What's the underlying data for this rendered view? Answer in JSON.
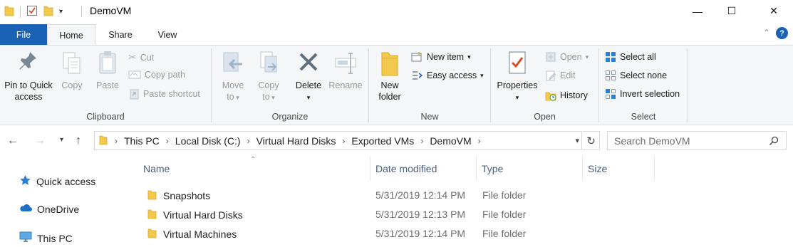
{
  "window": {
    "title": "DemoVM",
    "minimize_glyph": "—",
    "maximize_glyph": "☐",
    "close_glyph": "✕"
  },
  "tabs": [
    {
      "label": "File"
    },
    {
      "label": "Home"
    },
    {
      "label": "Share"
    },
    {
      "label": "View"
    }
  ],
  "ribbon": {
    "collapse_glyph": "⌃",
    "help_glyph": "?",
    "clipboard": {
      "label": "Clipboard",
      "pin": "Pin to Quick access",
      "pin_line1": "Pin to Quick",
      "pin_line2": "access",
      "copy": "Copy",
      "paste": "Paste",
      "cut": "Cut",
      "copy_path": "Copy path",
      "paste_shortcut": "Paste shortcut"
    },
    "organize": {
      "label": "Organize",
      "move_to_line1": "Move",
      "move_to_line2": "to",
      "copy_to_line1": "Copy",
      "copy_to_line2": "to",
      "delete": "Delete",
      "rename": "Rename"
    },
    "new": {
      "label": "New",
      "new_folder_line1": "New",
      "new_folder_line2": "folder",
      "new_item": "New item",
      "easy_access": "Easy access"
    },
    "open": {
      "label": "Open",
      "properties": "Properties",
      "open": "Open",
      "edit": "Edit",
      "history": "History"
    },
    "select": {
      "label": "Select",
      "select_all": "Select all",
      "select_none": "Select none",
      "invert_selection": "Invert selection"
    }
  },
  "address": {
    "crumbs": [
      "This PC",
      "Local Disk (C:)",
      "Virtual Hard Disks",
      "Exported VMs",
      "DemoVM"
    ]
  },
  "search": {
    "placeholder": "Search DemoVM"
  },
  "navpane": {
    "items": [
      {
        "label": "Quick access",
        "icon": "star-icon"
      },
      {
        "label": "OneDrive",
        "icon": "cloud-icon"
      },
      {
        "label": "This PC",
        "icon": "computer-icon"
      }
    ]
  },
  "columns": {
    "name": "Name",
    "date": "Date modified",
    "type": "Type",
    "size": "Size"
  },
  "files": [
    {
      "name": "Snapshots",
      "date": "5/31/2019 12:14 PM",
      "type": "File folder"
    },
    {
      "name": "Virtual Hard Disks",
      "date": "5/31/2019 12:13 PM",
      "type": "File folder"
    },
    {
      "name": "Virtual Machines",
      "date": "5/31/2019 12:14 PM",
      "type": "File folder"
    }
  ],
  "colors": {
    "accent": "#1a62b5",
    "folder": "#f2c94c",
    "ribbon_bg": "#f5f6f7"
  }
}
